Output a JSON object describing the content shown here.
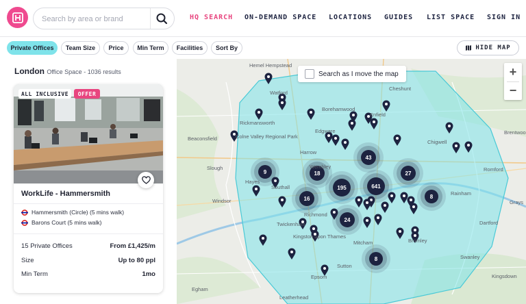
{
  "header": {
    "search_placeholder": "Search by area or brand",
    "nav": [
      {
        "label": "HQ SEARCH",
        "active": true
      },
      {
        "label": "ON-DEMAND SPACE",
        "active": false
      },
      {
        "label": "LOCATIONS",
        "active": false
      },
      {
        "label": "GUIDES",
        "active": false
      },
      {
        "label": "LIST SPACE",
        "active": false
      },
      {
        "label": "SIGN IN",
        "active": false
      }
    ]
  },
  "filters": {
    "chips": [
      {
        "label": "Private Offices",
        "active": true
      },
      {
        "label": "Team Size",
        "active": false
      },
      {
        "label": "Price",
        "active": false
      },
      {
        "label": "Min Term",
        "active": false
      },
      {
        "label": "Facilities",
        "active": false
      },
      {
        "label": "Sort By",
        "active": false
      }
    ],
    "hide_map_label": "HIDE MAP"
  },
  "results": {
    "city": "London",
    "summary": "Office Space - 1036 results"
  },
  "listing": {
    "badge_inclusive": "ALL INCLUSIVE",
    "badge_offer": "OFFER",
    "title": "WorkLife - Hammersmith",
    "stations": [
      "Hammersmith (Circle) (5 mins walk)",
      "Barons Court (5 mins walk)"
    ],
    "offices_label": "15 Private Offices",
    "price": "From £1,425/m",
    "size_label": "Size",
    "size_value": "Up to 80 ppl",
    "term_label": "Min Term",
    "term_value": "1mo"
  },
  "map": {
    "search_as_move_label": "Search as I move the map",
    "zoom_in": "+",
    "zoom_out": "−",
    "places": [
      "Hemel Hempstead",
      "Watford",
      "Borehamwood",
      "Cheshunt",
      "Enfield",
      "Edgware",
      "Rickmansworth",
      "Beaconsfield",
      "Harrow",
      "Wembley",
      "Romford",
      "Brentwood",
      "Colne Valley Regional Park",
      "Hayes",
      "Southall",
      "Slough",
      "Windsor",
      "Richmond",
      "Twickenham",
      "Kingston upon Thames",
      "Mitcham",
      "Sutton",
      "Epsom",
      "Leatherhead",
      "Bromley",
      "Dartford",
      "Grays",
      "Swanley",
      "Kingsdown",
      "Rainham",
      "Egham",
      "Chigwell"
    ],
    "clusters": [
      "9",
      "18",
      "195",
      "641",
      "43",
      "27",
      "16",
      "8",
      "24",
      "8"
    ],
    "accent_color": "#7fe3ea",
    "pin_color": "#1d2340"
  }
}
